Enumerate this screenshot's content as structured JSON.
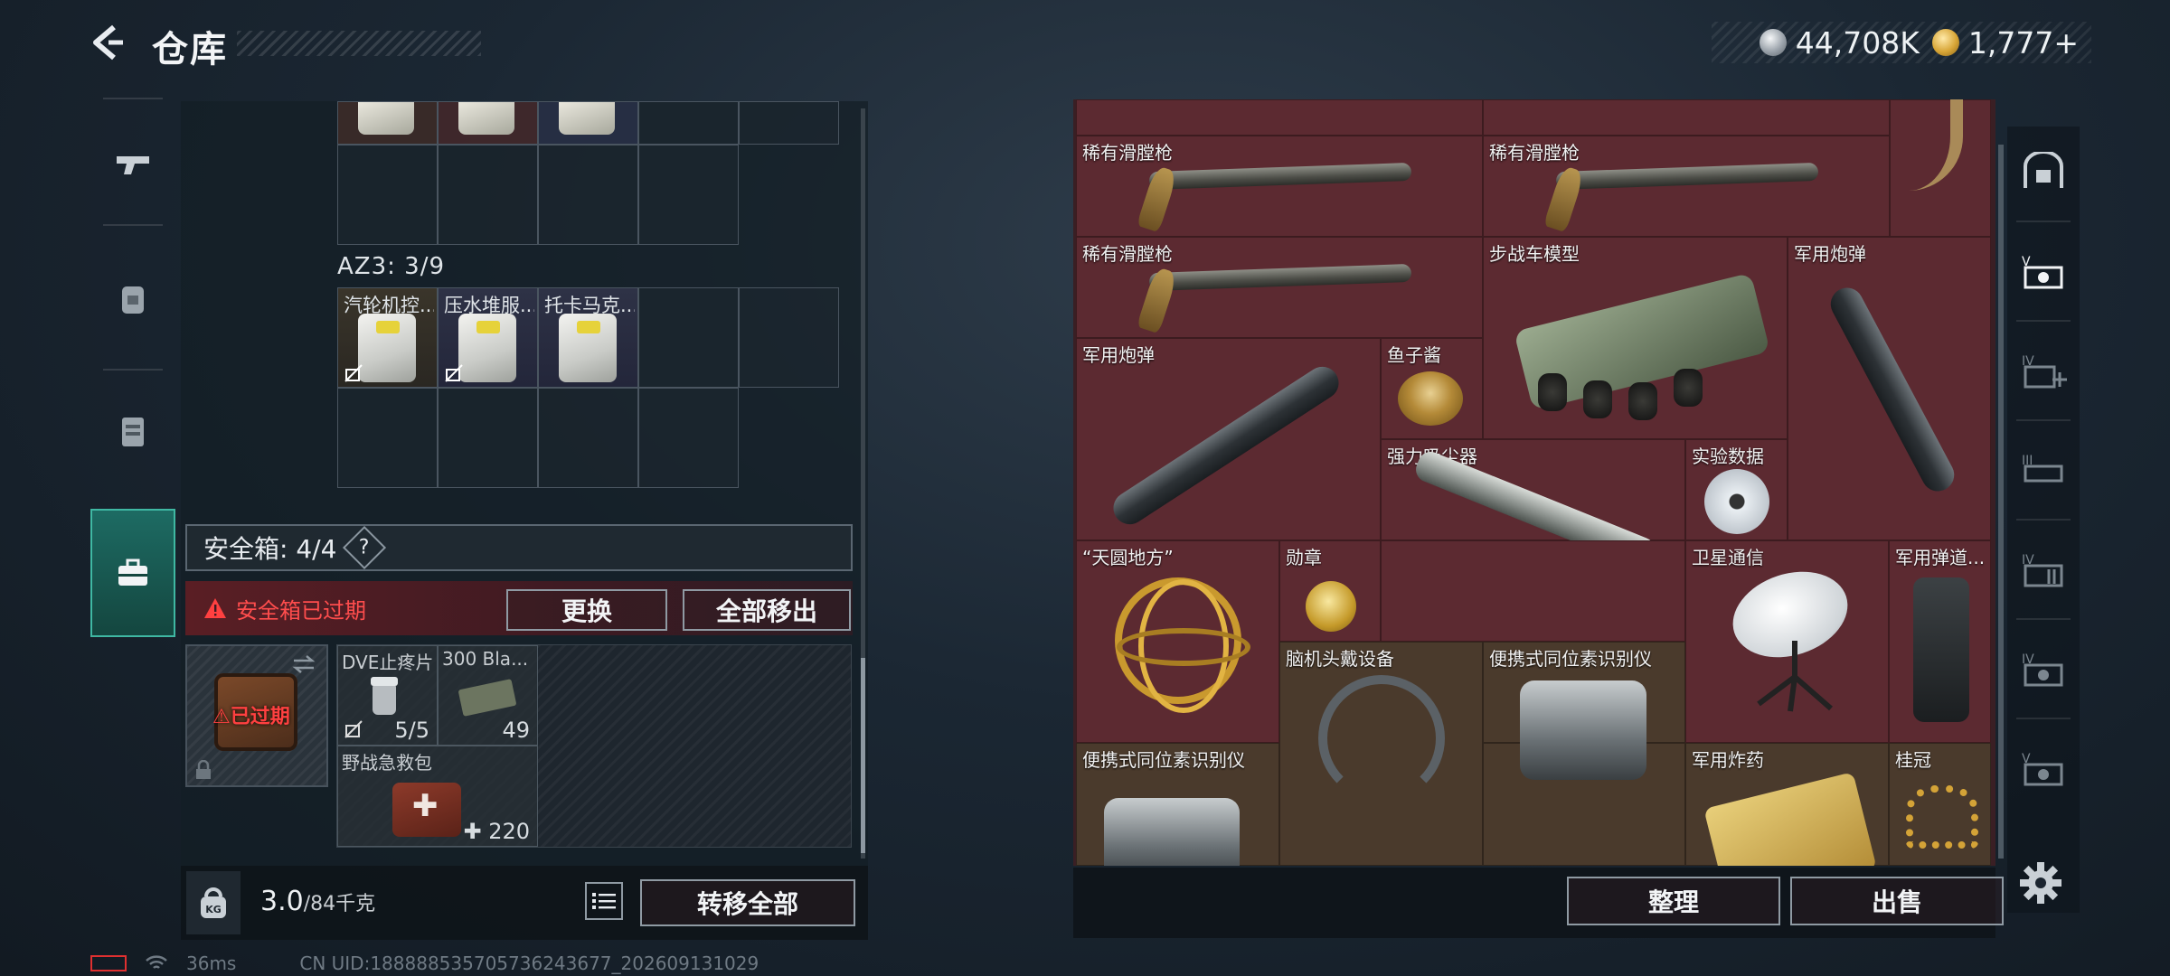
{
  "header": {
    "title": "仓库",
    "currencies": [
      {
        "icon": "silver-coin-icon",
        "value": "44,708K"
      },
      {
        "icon": "gold-coin-icon",
        "value": "1,777+"
      }
    ]
  },
  "left_sidebar": {
    "items": [
      {
        "icon": "gun-icon",
        "active": false
      },
      {
        "icon": "backpack-icon",
        "active": false
      },
      {
        "icon": "vest-icon",
        "active": false
      },
      {
        "icon": "briefcase-icon",
        "active": true
      }
    ]
  },
  "container": {
    "az3_label": "AZ3: 3/9",
    "az3_items": [
      "汽轮机控...",
      "压水堆服...",
      "托卡马克..."
    ]
  },
  "safe_box": {
    "label": "安全箱: 4/4",
    "help": "?",
    "expired_message": "安全箱已过期",
    "replace_button": "更换",
    "move_all_button": "全部移出",
    "case_status": "已过期",
    "items": [
      {
        "name": "DVE止疼片",
        "qty": "5/5"
      },
      {
        "name": "300 Bla...",
        "qty": "49"
      },
      {
        "name": "野战急救包",
        "qty": "220"
      }
    ]
  },
  "weight": {
    "kg_label": "KG",
    "current": "3.0",
    "max": "/84千克",
    "transfer_all_button": "转移全部"
  },
  "status_bar": {
    "ping": "36ms",
    "uid": "CN UID:188888535705736243677_202609131029"
  },
  "stash": {
    "items": [
      {
        "name": "稀有滑膛枪"
      },
      {
        "name": "稀有滑膛枪"
      },
      {
        "name": "稀有滑膛枪"
      },
      {
        "name": "步战车模型"
      },
      {
        "name": "军用炮弹"
      },
      {
        "name": "军用炮弹"
      },
      {
        "name": "鱼子酱"
      },
      {
        "name": "强力吸尘器"
      },
      {
        "name": "实验数据"
      },
      {
        "name": "“天圆地方”"
      },
      {
        "name": "勋章"
      },
      {
        "name": "卫星通信"
      },
      {
        "name": "军用弹道..."
      },
      {
        "name": "脑机头戴设备"
      },
      {
        "name": "便携式同位素识别仪"
      },
      {
        "name": "便携式同位素识别仪"
      },
      {
        "name": "军用炸药"
      },
      {
        "name": "桂冠"
      }
    ],
    "arrange_button": "整理",
    "sell_button": "出售"
  },
  "right_sidebar": {
    "items": [
      "safe-icon",
      "stash-v-icon",
      "stash-iv-add-icon",
      "stash-iii-icon",
      "stash-iv-icon",
      "stash-iv-safe-icon",
      "stash-v-safe-icon"
    ]
  }
}
